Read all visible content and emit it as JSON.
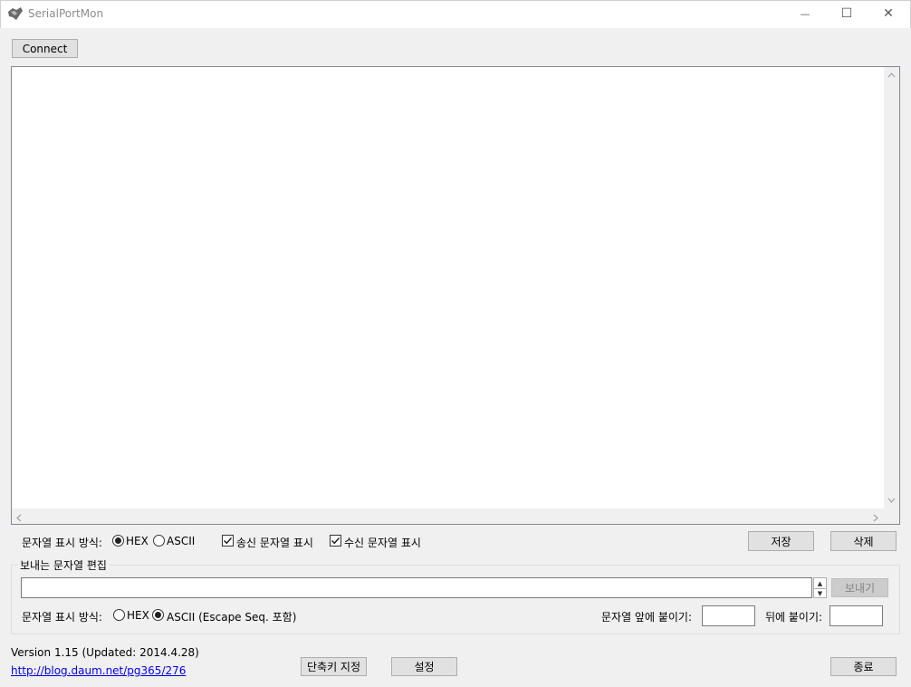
{
  "window": {
    "title": "SerialPortMon",
    "minimize_glyph": "—",
    "maximize_glyph": "☐",
    "close_glyph": "✕"
  },
  "toolbar": {
    "connect_label": "Connect"
  },
  "display_options": {
    "format_label": "문자열 표시 방식:",
    "hex_label": "HEX",
    "ascii_label": "ASCII",
    "selected_format": "HEX",
    "show_sent_label": "송신 문자열 표시",
    "show_sent_checked": true,
    "show_received_label": "수신 문자열 표시",
    "show_received_checked": true,
    "save_label": "저장",
    "delete_label": "삭제"
  },
  "send_group": {
    "title": "보내는 문자열 편집",
    "input_value": "",
    "send_label": "보내기",
    "send_enabled": false,
    "format_label": "문자열 표시 방식:",
    "hex_label": "HEX",
    "ascii_label": "ASCII (Escape Seq. 포함)",
    "selected_format": "ASCII",
    "prefix_label": "문자열 앞에 붙이기:",
    "prefix_value": "",
    "suffix_label": "뒤에 붙이기:",
    "suffix_value": ""
  },
  "footer": {
    "version_text": "Version 1.15 (Updated: 2014.4.28)",
    "link_text": "http://blog.daum.net/pg365/276",
    "shortcut_label": "단축키 지정",
    "settings_label": "설정",
    "exit_label": "종료"
  },
  "colors": {
    "window_bg": "#f0f0f0",
    "link": "#0000ee",
    "button_bg": "#e1e1e1",
    "button_border": "#adadad"
  },
  "icons": {
    "app": "app-icon",
    "minimize": "minimize-icon",
    "maximize": "maximize-icon",
    "close": "close-icon"
  }
}
